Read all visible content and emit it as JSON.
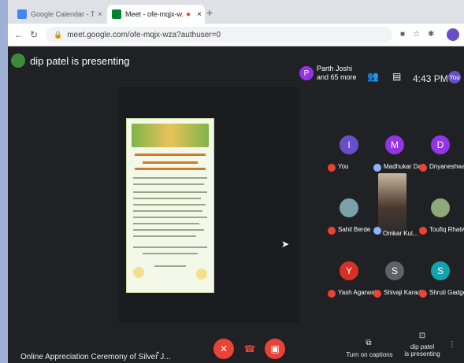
{
  "browser": {
    "tabs": [
      {
        "title": "Google Calendar - Thursday, Ja...",
        "active": false,
        "favicon_color": "#4285f4"
      },
      {
        "title": "Meet - ofe-mqjx-wza",
        "active": true,
        "favicon_color": "#00832d"
      }
    ],
    "url": "meet.google.com/ofe-mqjx-wza?authuser=0"
  },
  "meet": {
    "presenting_text": "dip patel is presenting",
    "participants": {
      "avatar_letter": "P",
      "name": "Parth Joshi",
      "more": "and 65 more"
    },
    "time": "4:43 PM",
    "self_label": "You",
    "tiles": [
      {
        "name": "You",
        "initial": "I",
        "color": "#6a4ec9",
        "muted": true
      },
      {
        "name": "Madhukar Da...",
        "initial": "M",
        "color": "#9334e6",
        "muted": false
      },
      {
        "name": "Dnyaneshwar",
        "initial": "D",
        "color": "#9334e6",
        "muted": true
      },
      {
        "name": "Sahil Berde",
        "initial": "",
        "color": "#3c4043",
        "muted": true
      },
      {
        "name": "Omkar Kul...",
        "initial": "",
        "color": "#3c4043",
        "muted": false
      },
      {
        "name": "Toufiq Rhatw...",
        "initial": "",
        "color": "#3c4043",
        "muted": true
      },
      {
        "name": "Yash Agarwal",
        "initial": "Y",
        "color": "#d93025",
        "muted": true
      },
      {
        "name": "Shivaji Karad",
        "initial": "S",
        "color": "#5f6368",
        "muted": true
      },
      {
        "name": "Shruti Gadge",
        "initial": "S",
        "color": "#12a4af",
        "muted": true
      }
    ],
    "bottom": {
      "meeting_title": "Online Appreciation Ceremony of Silver J...",
      "captions_label": "Turn on captions",
      "presenter_label_1": "dip patel",
      "presenter_label_2": "is presenting"
    }
  }
}
